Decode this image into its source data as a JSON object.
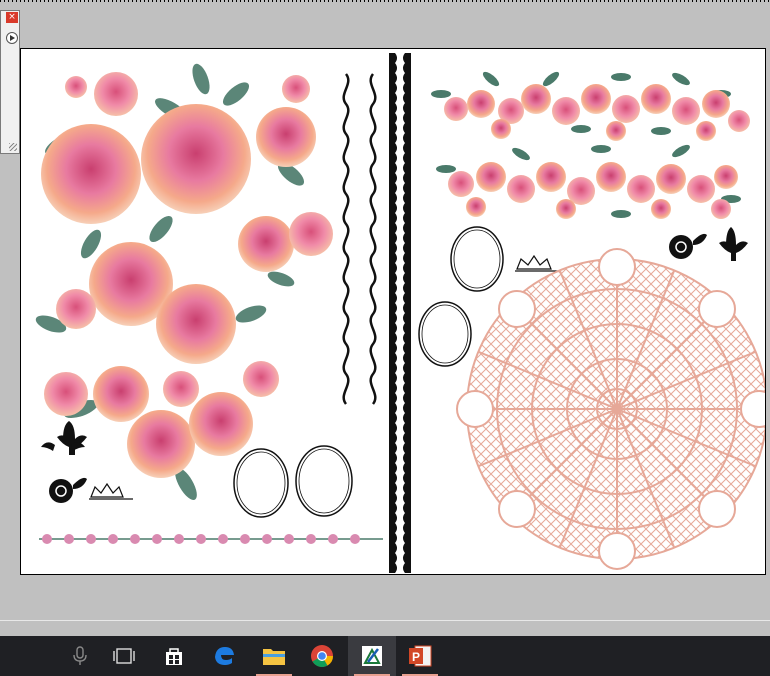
{
  "window": {
    "close_label": "×",
    "panel_menu_icon": "play-circle-icon"
  },
  "taskbar": {
    "items": [
      {
        "name": "microphone-icon"
      },
      {
        "name": "task-view-icon"
      },
      {
        "name": "store-icon"
      },
      {
        "name": "edge-icon"
      },
      {
        "name": "file-explorer-icon"
      },
      {
        "name": "chrome-icon"
      },
      {
        "name": "image-editor-icon"
      },
      {
        "name": "powerpoint-icon"
      }
    ],
    "powerpoint_letter": "P",
    "colors": {
      "edge": "#1d7be0",
      "explorer": "#f5c342",
      "chrome_red": "#db4437",
      "chrome_green": "#0f9d58",
      "chrome_yellow": "#f4b400",
      "chrome_blue": "#4285f4",
      "powerpoint": "#d24726"
    }
  },
  "artwork": {
    "rose_colors": [
      "#e87aa0",
      "#f5a98a",
      "#f0c0a0",
      "#d85a8a"
    ],
    "leaf_color": "#4a7a6a",
    "doily_color": "#e8b0a0",
    "ornament_color": "#111111"
  }
}
